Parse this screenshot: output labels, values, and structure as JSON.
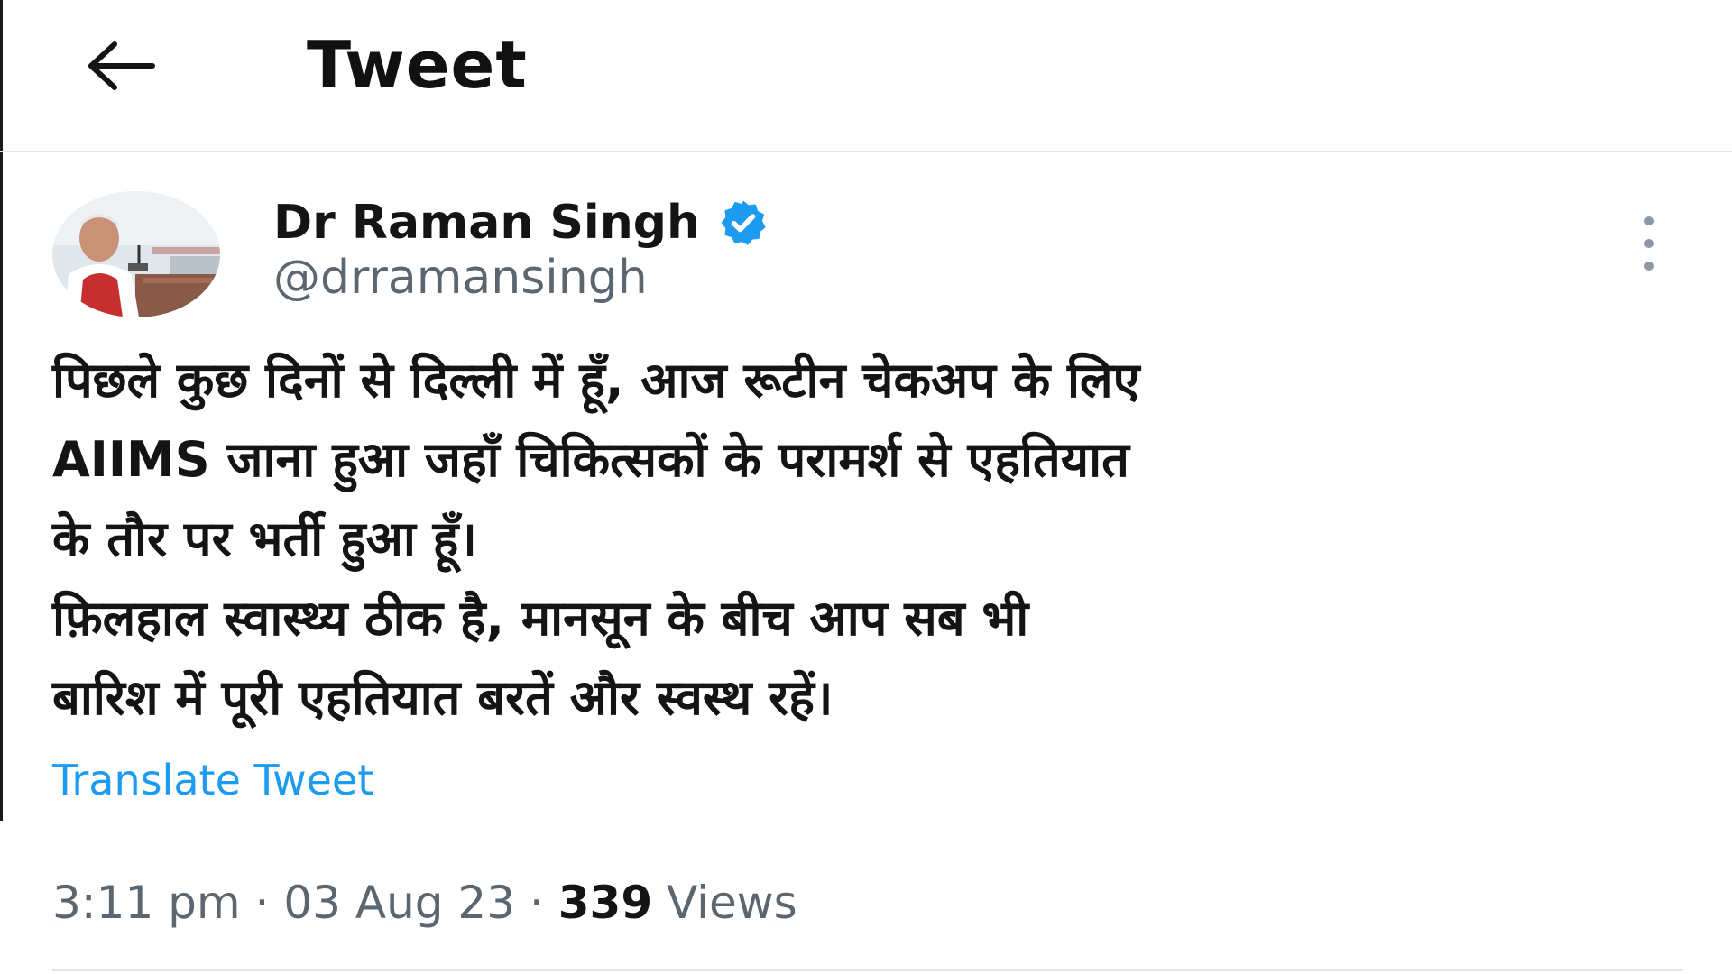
{
  "header": {
    "back_icon": "arrow-left-icon",
    "title": "Tweet"
  },
  "author": {
    "name": "Dr Raman Singh",
    "handle": "@drramansingh",
    "verified_icon": "verified-badge-icon",
    "verified_color": "#1d9bf0"
  },
  "more_icon": "more-vertical-icon",
  "tweet": {
    "lines": [
      "पिछले कुछ दिनों से दिल्ली में हूँ, आज रूटीन चेकअप के लिए",
      "AIIMS जाना हुआ जहाँ चिकित्सकों के परामर्श से एहतियात",
      "के तौर पर भर्ती हुआ हूँ।",
      "फ़िलहाल स्वास्थ्य ठीक है, मानसून के बीच आप सब भी",
      "बारिश में पूरी एहतियात बरतें और स्वस्थ रहें।"
    ]
  },
  "translate_label": "Translate Tweet",
  "meta": {
    "time": "3:11 pm",
    "separator": "·",
    "date": "03 Aug 23",
    "views_count": "339",
    "views_label": "Views"
  },
  "colors": {
    "link": "#1d9bf0",
    "text_primary": "#141414",
    "text_secondary": "#5b6670"
  }
}
